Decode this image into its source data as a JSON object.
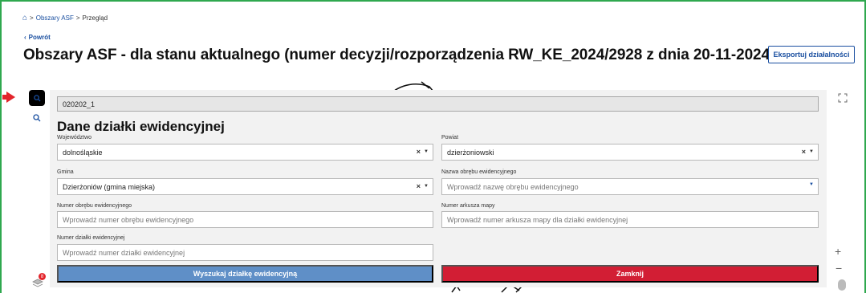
{
  "breadcrumb": {
    "home_icon": "home-icon",
    "items": [
      "Obszary ASF",
      "Przegląd"
    ],
    "separator": ">"
  },
  "back": {
    "label": "Powrót",
    "icon": "chevron-left-icon"
  },
  "page_title": "Obszary ASF - dla stanu aktualnego (numer decyzji/rozporządzenia RW_KE_2024/2928 z dnia 20-11-2024)",
  "export_button": "Eksportuj działalności",
  "map_tools": {
    "active_search_icon": "search-icon",
    "search_icon": "search-icon",
    "layers_badge_count": "8",
    "zoom_in": "+",
    "zoom_out": "−"
  },
  "panel": {
    "search_value": "020202_1",
    "title": "Dane działki ewidencyjnej",
    "fields": {
      "wojewodztwo": {
        "label": "Województwo",
        "value": "dolnośląskie"
      },
      "powiat": {
        "label": "Powiat",
        "value": "dzierżoniowski"
      },
      "gmina": {
        "label": "Gmina",
        "value": "Dzierżoniów (gmina miejska)"
      },
      "obreb_nazwa": {
        "label": "Nazwa obrębu ewidencyjnego",
        "placeholder": "Wprowadź nazwę obrębu ewidencyjnego"
      },
      "obreb_numer": {
        "label": "Numer obrębu ewidencyjnego",
        "placeholder": "Wprowadź numer obrębu ewidencyjnego"
      },
      "arkusz": {
        "label": "Numer arkusza mapy",
        "placeholder": "Wprowadź numer arkusza mapy dla działki ewidencyjnej"
      },
      "dzialka": {
        "label": "Numer działki ewidencyjnej",
        "placeholder": "Wprowadź numer działki ewidencyjnej"
      }
    },
    "clear_symbol": "×",
    "caret_symbol": "▼",
    "search_button": "Wyszukaj działkę ewidencyjną",
    "close_button": "Zamknij"
  },
  "colors": {
    "accent": "#1a4fa0",
    "search_button": "#5f8fc7",
    "close_button": "#d21e34",
    "badge": "#e3242b",
    "frame": "#2fa84f"
  }
}
